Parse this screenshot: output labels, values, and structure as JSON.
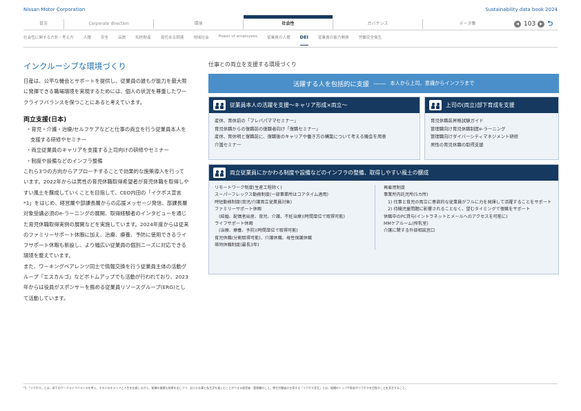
{
  "header": {
    "corp": "Nissan Motor Corporation",
    "book": "Sustainability data book 2024",
    "tabs": [
      "目次",
      "Corporate direction",
      "環境",
      "社会性",
      "ガバナンス",
      "データ集"
    ],
    "active_tab": 3,
    "page": "103",
    "prev_icon": "◀",
    "next_icon": "▶",
    "back_icon": "⮌"
  },
  "subnav": {
    "items": [
      "社会性に関する方針・考え方",
      "人権",
      "安全",
      "品質",
      "知的財産",
      "責任ある調達",
      "地域社会",
      "Power of employees",
      "従業員の人権",
      "DEI",
      "従業員の能力開発",
      "労働安全衛生"
    ],
    "active": 9
  },
  "left": {
    "title": "インクルーシブな環境づくり",
    "intro": "日産は、公平な機会とサポートを提供し、従業員の誰もが能力を最大限に発揮できる職場環境を実現するためには、個人の状況を尊重したワークライフバランスを保つことにあると考えています。",
    "section_title": "両立支援(日本)",
    "bullets": [
      "・育児・介護・治療/セルフケアなどと仕事の両立を行う従業員本人を支援する研修やセミナー",
      "・両立従業員のキャリアを支援する上司向けの研修やセミナー",
      "・制度や設備などのインフラ整備"
    ],
    "body1": "これら3つの方向からアプローチすることで効果的な施策導入を行っています。2022年からは男性の育児休職取得希望者が育児休職を取得しやすい風土を醸成していくことを目指して、CEO内田の「イクボス宣言*1」をはじめ、経営層や部課長層からの応援メッセージ発信、部課長層対象受講必須のe-ラーニングの展開、取得経験者のインタビューを通じた育児休職取得実例の展開などを実施しています。2024年度からは従来のファミリーサポート休暇に加え、治療、療養、予防に使用できるライフサポート休暇も新設し、より幅広い従業員の個別ニーズに対応できる環境を整えています。",
    "body2": "また、ワーキングペアレンツ同士で情報交換を行う従業員主体の活動グループ「エスカルゴ」などボトムアップでも活動が行われており、2023年からは役員がスポンサーを務める従業員リソースグループ(ERG)として活動しています。"
  },
  "right": {
    "caption": "仕事との両立を支援する環境づくり",
    "banner_main": "活躍する人を包括的に支援",
    "banner_dash": "——",
    "banner_sub": "本人から上司、意識からインフラまで",
    "box_a_title": "従業員本人の活躍を支援〜キャリア形成×両立〜",
    "box_a_items": [
      "産休、育休前の「プレパパママセミナー」",
      "育児休職からの復職前の復職者向け「復職セミナー」",
      "産休、育休明と復職前に、復職後のキャリアや働き方の構築について考える機会を用意",
      "介護セミナー"
    ],
    "box_b_title": "上司の(両立)部下育成を支援",
    "box_b_items": [
      "育児休職前昇格試験ガイド",
      "管理職向け育児休職制度e-ラーニング",
      "管理職向けダイバーシティマネジメント研修",
      "男性の育児休職の取得支援"
    ],
    "box_c_title": "両立従業員にかかわる制度や設備などのインフラの整備、取得しやすい風土の醸成",
    "box_c_col1": [
      "リモートワーク制度(生産工程除く)",
      "スーパーフレックス勤務制度(一部事業所はコアタイム適用)",
      "時短勤務制度(育児/介護両立従業員対象)",
      "ファミリーサポート休暇",
      "(結婚、配偶者出産、育児、介護、不妊治療)(時間単位で取得可能)",
      "ライフサポート休暇",
      "(治療、療養、予防)(時間単位で取得可能)",
      "育児休職(分割取得可能)、介護休職、母性保護休職",
      "帯同休職制度(最長3年)"
    ],
    "box_c_col2": [
      "再雇用制度",
      "事業所内託児所(5カ所)",
      "1) 仕事と育児の両立に意欲的な従業員がフルに力を発揮して活躍することをサポート",
      "2) 待機児童問題に影響されることなく、望むタイミングで復職をサポート",
      "休職中のPC貸与(イントラネットとメールへのアクセスを可能に)",
      "MMケアルーム(搾乳室)",
      "介護に関する外部相談窓口"
    ]
  },
  "footnote": "*1 「イクボス」とは、部下のワークライフバランスを考え、その人のキャリアと人生を応援しながら、組織の業績も結果を出しつつ、自らも仕事と私生活を楽しむことができる経営者・管理職のこと。厚生労働省の主導する「イクボス宣言」とは、組織のトップや幹部がイクボスを目指すことを宣言すること。"
}
